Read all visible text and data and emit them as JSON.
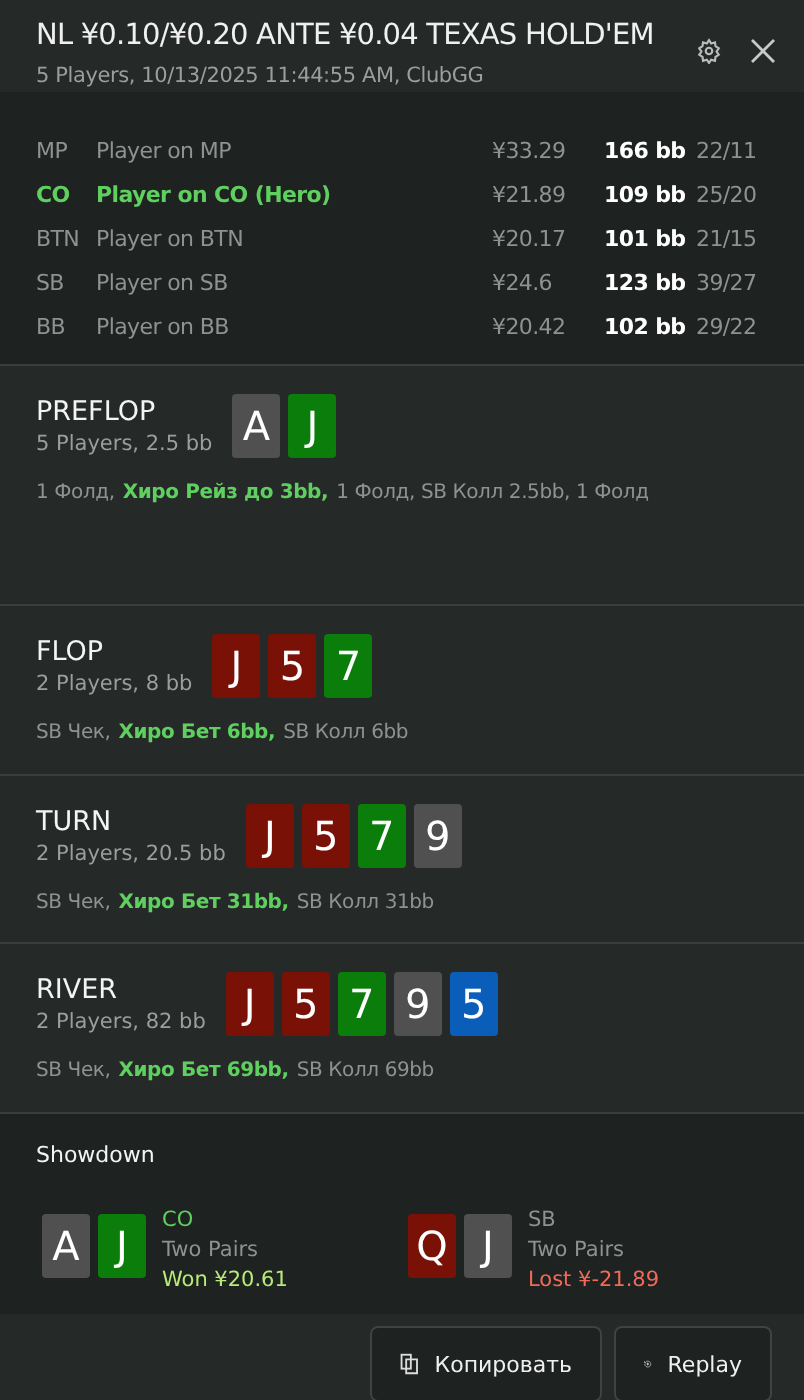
{
  "header": {
    "title": "NL ¥0.10/¥0.20 ANTE ¥0.04 TEXAS HOLD'EM",
    "subtitle": "5 Players, 10/13/2025 11:44:55 AM, ClubGG"
  },
  "players": [
    {
      "position": "MP",
      "name": "Player on MP",
      "stack": "¥33.29",
      "bb": "166 bb",
      "stats": "22/11",
      "hero": false
    },
    {
      "position": "CO",
      "name": "Player on CO (Hero)",
      "stack": "¥21.89",
      "bb": "109 bb",
      "stats": "25/20",
      "hero": true
    },
    {
      "position": "BTN",
      "name": "Player on BTN",
      "stack": "¥20.17",
      "bb": "101 bb",
      "stats": "21/15",
      "hero": false
    },
    {
      "position": "SB",
      "name": "Player on SB",
      "stack": "¥24.6",
      "bb": "123 bb",
      "stats": "39/27",
      "hero": false
    },
    {
      "position": "BB",
      "name": "Player on BB",
      "stack": "¥20.42",
      "bb": "102 bb",
      "stats": "29/22",
      "hero": false
    }
  ],
  "streets": [
    {
      "name": "PREFLOP",
      "info": "5 Players, 2.5 bb",
      "cards": [
        {
          "rank": "A",
          "color": "#505050"
        },
        {
          "rank": "J",
          "color": "#0a7d0a"
        }
      ],
      "actions": [
        {
          "text": "1 Фолд,",
          "hero": false
        },
        {
          "text": "Хиро Рейз до 3bb,",
          "hero": true
        },
        {
          "text": "1 Фолд, SB Колл 2.5bb, 1 Фолд",
          "hero": false
        }
      ]
    },
    {
      "name": "FLOP",
      "info": "2 Players, 8 bb",
      "cards": [
        {
          "rank": "J",
          "color": "#7a1106"
        },
        {
          "rank": "5",
          "color": "#7a1106"
        },
        {
          "rank": "7",
          "color": "#0a7d0a"
        }
      ],
      "actions": [
        {
          "text": "SB Чек,",
          "hero": false
        },
        {
          "text": "Хиро Бет 6bb,",
          "hero": true
        },
        {
          "text": "SB Колл 6bb",
          "hero": false
        }
      ]
    },
    {
      "name": "TURN",
      "info": "2 Players, 20.5 bb",
      "cards": [
        {
          "rank": "J",
          "color": "#7a1106"
        },
        {
          "rank": "5",
          "color": "#7a1106"
        },
        {
          "rank": "7",
          "color": "#0a7d0a"
        },
        {
          "rank": "9",
          "color": "#505050"
        }
      ],
      "actions": [
        {
          "text": "SB Чек,",
          "hero": false
        },
        {
          "text": "Хиро Бет 31bb,",
          "hero": true
        },
        {
          "text": "SB Колл 31bb",
          "hero": false
        }
      ]
    },
    {
      "name": "RIVER",
      "info": "2 Players, 82 bb",
      "cards": [
        {
          "rank": "J",
          "color": "#7a1106"
        },
        {
          "rank": "5",
          "color": "#7a1106"
        },
        {
          "rank": "7",
          "color": "#0a7d0a"
        },
        {
          "rank": "9",
          "color": "#505050"
        },
        {
          "rank": "5",
          "color": "#0a5db8"
        }
      ],
      "actions": [
        {
          "text": "SB Чек,",
          "hero": false
        },
        {
          "text": "Хиро Бет 69bb,",
          "hero": true
        },
        {
          "text": "SB Колл 69bb",
          "hero": false
        }
      ]
    }
  ],
  "showdown": {
    "title": "Showdown",
    "hands": [
      {
        "position": "CO",
        "hero": true,
        "cards": [
          {
            "rank": "A",
            "color": "#505050"
          },
          {
            "rank": "J",
            "color": "#0a7d0a"
          }
        ],
        "combo": "Two Pairs",
        "result": "Won ¥20.61",
        "won": true
      },
      {
        "position": "SB",
        "hero": false,
        "cards": [
          {
            "rank": "Q",
            "color": "#7a1106"
          },
          {
            "rank": "J",
            "color": "#505050"
          }
        ],
        "combo": "Two Pairs",
        "result": "Lost ¥-21.89",
        "won": false
      }
    ]
  },
  "buttons": [
    {
      "kind": "copy",
      "label": "Копировать"
    },
    {
      "kind": "replay",
      "label": "Replay"
    }
  ]
}
